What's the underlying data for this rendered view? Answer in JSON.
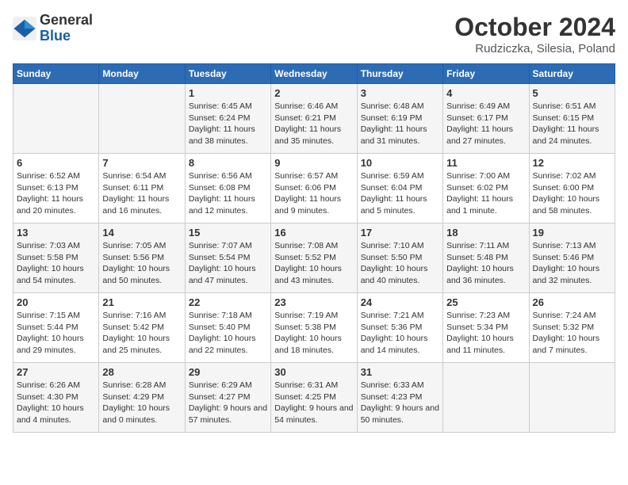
{
  "logo": {
    "general": "General",
    "blue": "Blue"
  },
  "title": "October 2024",
  "location": "Rudziczka, Silesia, Poland",
  "weekdays": [
    "Sunday",
    "Monday",
    "Tuesday",
    "Wednesday",
    "Thursday",
    "Friday",
    "Saturday"
  ],
  "weeks": [
    [
      {
        "day": "",
        "info": ""
      },
      {
        "day": "",
        "info": ""
      },
      {
        "day": "1",
        "info": "Sunrise: 6:45 AM\nSunset: 6:24 PM\nDaylight: 11 hours and 38 minutes."
      },
      {
        "day": "2",
        "info": "Sunrise: 6:46 AM\nSunset: 6:21 PM\nDaylight: 11 hours and 35 minutes."
      },
      {
        "day": "3",
        "info": "Sunrise: 6:48 AM\nSunset: 6:19 PM\nDaylight: 11 hours and 31 minutes."
      },
      {
        "day": "4",
        "info": "Sunrise: 6:49 AM\nSunset: 6:17 PM\nDaylight: 11 hours and 27 minutes."
      },
      {
        "day": "5",
        "info": "Sunrise: 6:51 AM\nSunset: 6:15 PM\nDaylight: 11 hours and 24 minutes."
      }
    ],
    [
      {
        "day": "6",
        "info": "Sunrise: 6:52 AM\nSunset: 6:13 PM\nDaylight: 11 hours and 20 minutes."
      },
      {
        "day": "7",
        "info": "Sunrise: 6:54 AM\nSunset: 6:11 PM\nDaylight: 11 hours and 16 minutes."
      },
      {
        "day": "8",
        "info": "Sunrise: 6:56 AM\nSunset: 6:08 PM\nDaylight: 11 hours and 12 minutes."
      },
      {
        "day": "9",
        "info": "Sunrise: 6:57 AM\nSunset: 6:06 PM\nDaylight: 11 hours and 9 minutes."
      },
      {
        "day": "10",
        "info": "Sunrise: 6:59 AM\nSunset: 6:04 PM\nDaylight: 11 hours and 5 minutes."
      },
      {
        "day": "11",
        "info": "Sunrise: 7:00 AM\nSunset: 6:02 PM\nDaylight: 11 hours and 1 minute."
      },
      {
        "day": "12",
        "info": "Sunrise: 7:02 AM\nSunset: 6:00 PM\nDaylight: 10 hours and 58 minutes."
      }
    ],
    [
      {
        "day": "13",
        "info": "Sunrise: 7:03 AM\nSunset: 5:58 PM\nDaylight: 10 hours and 54 minutes."
      },
      {
        "day": "14",
        "info": "Sunrise: 7:05 AM\nSunset: 5:56 PM\nDaylight: 10 hours and 50 minutes."
      },
      {
        "day": "15",
        "info": "Sunrise: 7:07 AM\nSunset: 5:54 PM\nDaylight: 10 hours and 47 minutes."
      },
      {
        "day": "16",
        "info": "Sunrise: 7:08 AM\nSunset: 5:52 PM\nDaylight: 10 hours and 43 minutes."
      },
      {
        "day": "17",
        "info": "Sunrise: 7:10 AM\nSunset: 5:50 PM\nDaylight: 10 hours and 40 minutes."
      },
      {
        "day": "18",
        "info": "Sunrise: 7:11 AM\nSunset: 5:48 PM\nDaylight: 10 hours and 36 minutes."
      },
      {
        "day": "19",
        "info": "Sunrise: 7:13 AM\nSunset: 5:46 PM\nDaylight: 10 hours and 32 minutes."
      }
    ],
    [
      {
        "day": "20",
        "info": "Sunrise: 7:15 AM\nSunset: 5:44 PM\nDaylight: 10 hours and 29 minutes."
      },
      {
        "day": "21",
        "info": "Sunrise: 7:16 AM\nSunset: 5:42 PM\nDaylight: 10 hours and 25 minutes."
      },
      {
        "day": "22",
        "info": "Sunrise: 7:18 AM\nSunset: 5:40 PM\nDaylight: 10 hours and 22 minutes."
      },
      {
        "day": "23",
        "info": "Sunrise: 7:19 AM\nSunset: 5:38 PM\nDaylight: 10 hours and 18 minutes."
      },
      {
        "day": "24",
        "info": "Sunrise: 7:21 AM\nSunset: 5:36 PM\nDaylight: 10 hours and 14 minutes."
      },
      {
        "day": "25",
        "info": "Sunrise: 7:23 AM\nSunset: 5:34 PM\nDaylight: 10 hours and 11 minutes."
      },
      {
        "day": "26",
        "info": "Sunrise: 7:24 AM\nSunset: 5:32 PM\nDaylight: 10 hours and 7 minutes."
      }
    ],
    [
      {
        "day": "27",
        "info": "Sunrise: 6:26 AM\nSunset: 4:30 PM\nDaylight: 10 hours and 4 minutes."
      },
      {
        "day": "28",
        "info": "Sunrise: 6:28 AM\nSunset: 4:29 PM\nDaylight: 10 hours and 0 minutes."
      },
      {
        "day": "29",
        "info": "Sunrise: 6:29 AM\nSunset: 4:27 PM\nDaylight: 9 hours and 57 minutes."
      },
      {
        "day": "30",
        "info": "Sunrise: 6:31 AM\nSunset: 4:25 PM\nDaylight: 9 hours and 54 minutes."
      },
      {
        "day": "31",
        "info": "Sunrise: 6:33 AM\nSunset: 4:23 PM\nDaylight: 9 hours and 50 minutes."
      },
      {
        "day": "",
        "info": ""
      },
      {
        "day": "",
        "info": ""
      }
    ]
  ]
}
